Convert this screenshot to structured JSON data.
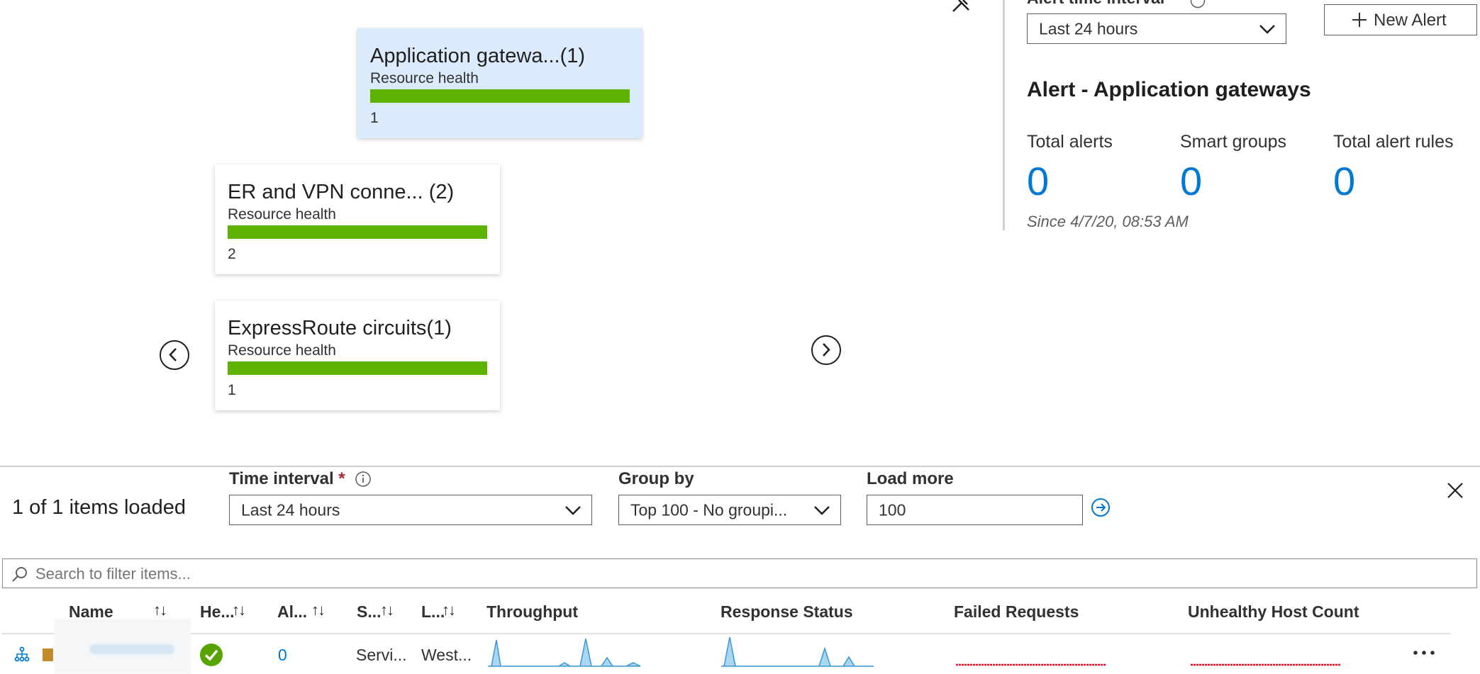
{
  "cards": [
    {
      "title": "Application gatewa...(1)",
      "subtitle": "Resource health",
      "count": "1",
      "health": 1.0,
      "selected": true
    },
    {
      "title": "ER and VPN conne...  (2)",
      "subtitle": "Resource health",
      "count": "2",
      "health": 1.0,
      "selected": false
    },
    {
      "title": "ExpressRoute circuits(1)",
      "subtitle": "Resource health",
      "count": "1",
      "health": 1.0,
      "selected": false
    }
  ],
  "alerts_panel": {
    "interval_label": "Alert time interval",
    "interval_value": "Last 24 hours",
    "new_alert_label": "New Alert",
    "title": "Alert - Application gateways",
    "stats": [
      {
        "label": "Total alerts",
        "value": "0"
      },
      {
        "label": "Smart groups",
        "value": "0"
      },
      {
        "label": "Total alert rules",
        "value": "0"
      }
    ],
    "since": "Since 4/7/20, 08:53 AM"
  },
  "toolbar": {
    "items_loaded": "1 of 1 items loaded",
    "time_interval_label": "Time interval",
    "required_mark": "*",
    "time_interval_value": "Last 24 hours",
    "group_by_label": "Group by",
    "group_by_value": "Top 100 - No groupi...",
    "load_more_label": "Load more",
    "load_more_value": "100"
  },
  "search": {
    "placeholder": "Search to filter items..."
  },
  "table": {
    "headers": {
      "name": "Name",
      "health": "He...",
      "alerts": "Al...",
      "status": "S...",
      "location": "L...",
      "throughput": "Throughput",
      "response": "Response Status",
      "failed": "Failed Requests",
      "unhealthy": "Unhealthy Host Count"
    },
    "rows": [
      {
        "alerts": "0",
        "status": "Servi...",
        "location": "West..."
      }
    ]
  },
  "colors": {
    "accent": "#0078d4",
    "health_green": "#5db300",
    "selected_card": "#dcebfb",
    "spark": "#74bde8",
    "failed": "#e81123"
  }
}
